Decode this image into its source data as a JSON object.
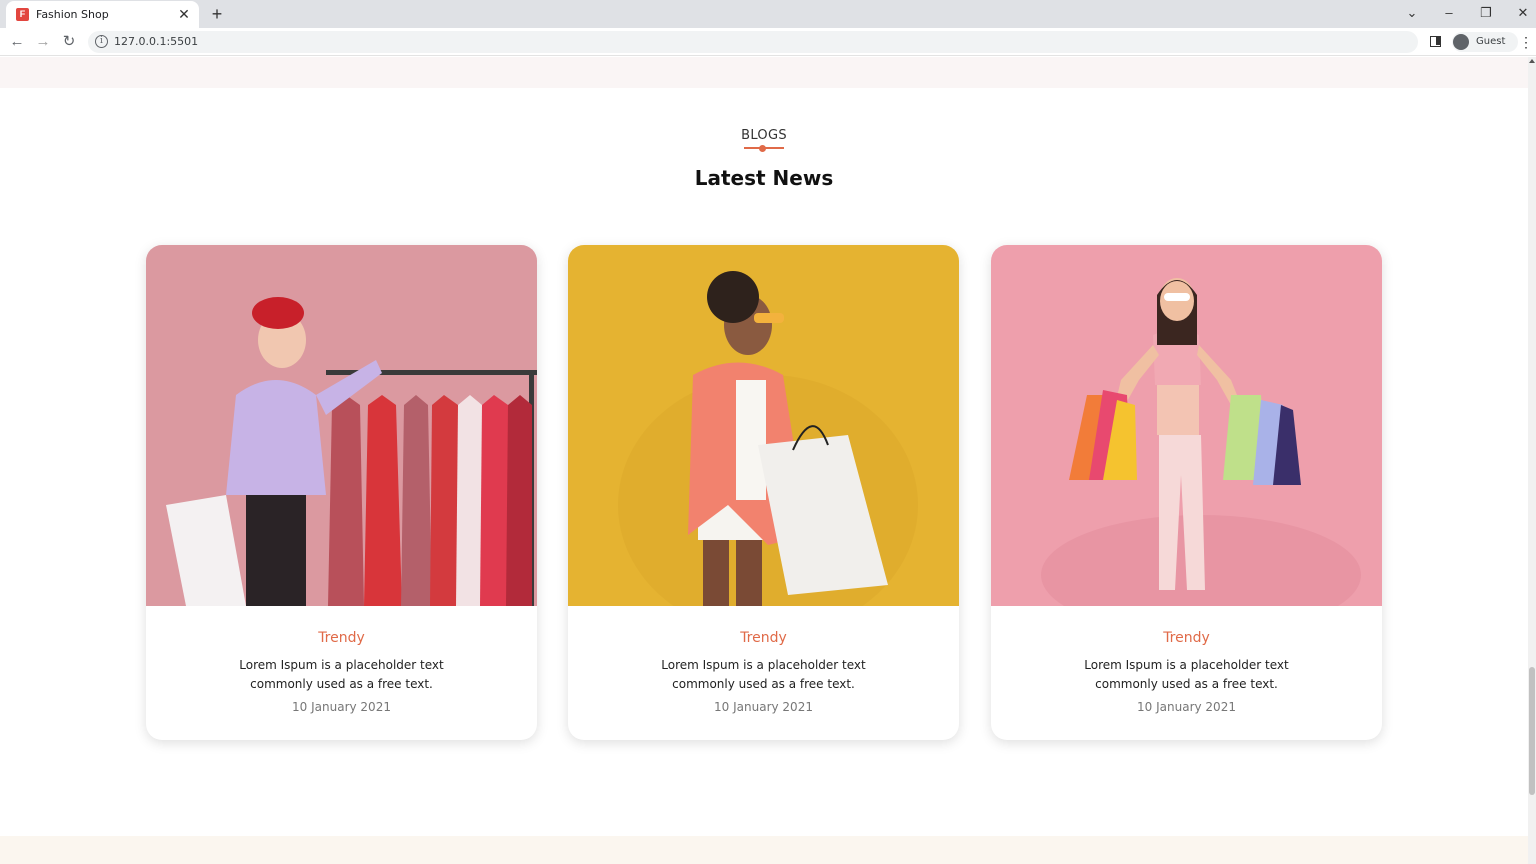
{
  "browser": {
    "tab_title": "Fashion Shop",
    "favicon_letter": "F",
    "url": "127.0.0.1:5501",
    "profile_label": "Guest"
  },
  "section": {
    "tag": "BLOGS",
    "title": "Latest News"
  },
  "colors": {
    "accent": "#e06a48",
    "card1_bg": "#d5929a",
    "card2_bg": "#e5b331",
    "card3_bg": "#ee9fac"
  },
  "cards": [
    {
      "category": "Trendy",
      "text": "Lorem Ispum is a placeholder text commonly used as a free text.",
      "date": "10 January 2021",
      "image": "woman-with-clothes-rack-photo"
    },
    {
      "category": "Trendy",
      "text": "Lorem Ispum is a placeholder text commonly used as a free text.",
      "date": "10 January 2021",
      "image": "woman-with-shopping-bags-photo"
    },
    {
      "category": "Trendy",
      "text": "Lorem Ispum is a placeholder text commonly used as a free text.",
      "date": "10 January 2021",
      "image": "woman-with-colorful-bags-photo"
    }
  ]
}
